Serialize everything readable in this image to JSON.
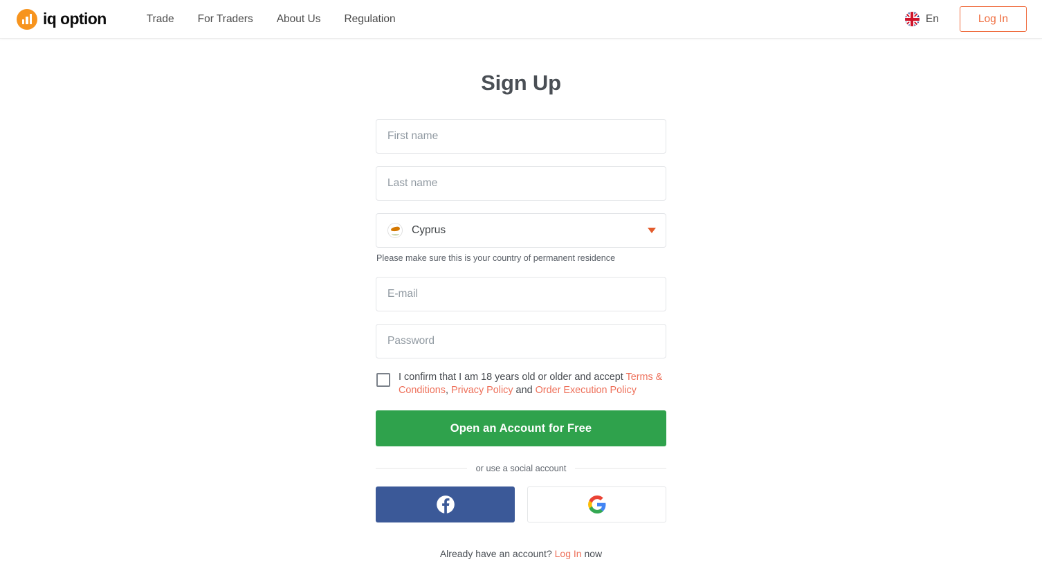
{
  "header": {
    "logo": {
      "text": "iq option",
      "icon": "bar-chart-logo-icon",
      "color": "#f7941e"
    },
    "nav": [
      {
        "label": "Trade"
      },
      {
        "label": "For Traders"
      },
      {
        "label": "About Us"
      },
      {
        "label": "Regulation"
      }
    ],
    "language": {
      "label": "En",
      "flag": "uk-flag-icon"
    },
    "login_label": "Log In",
    "login_color": "#ef6c3e"
  },
  "form": {
    "title": "Sign Up",
    "first_name_placeholder": "First name",
    "first_name_value": "",
    "last_name_placeholder": "Last name",
    "last_name_value": "",
    "country_value": "Cyprus",
    "country_flag": "cyprus-flag-icon",
    "country_hint": "Please make sure this is your country of permanent residence",
    "email_placeholder": "E-mail",
    "email_value": "",
    "password_placeholder": "Password",
    "password_value": "",
    "consent": {
      "checked": false,
      "intro": "I confirm that I am 18 years old or older and accept ",
      "link_terms": "Terms & Conditions",
      "sep1": ", ",
      "link_privacy": "Privacy Policy",
      "sep2": " and ",
      "link_order": "Order Execution Policy"
    },
    "submit_label": "Open an Account for Free",
    "submit_color": "#2fa24c",
    "divider_label": "or use a social account",
    "social": [
      {
        "name": "facebook",
        "icon": "facebook-icon",
        "color": "#3b5998"
      },
      {
        "name": "google",
        "icon": "google-icon",
        "color": "#ffffff"
      }
    ],
    "footer": {
      "prefix": "Already have an account? ",
      "link": "Log In",
      "suffix": " now"
    }
  }
}
